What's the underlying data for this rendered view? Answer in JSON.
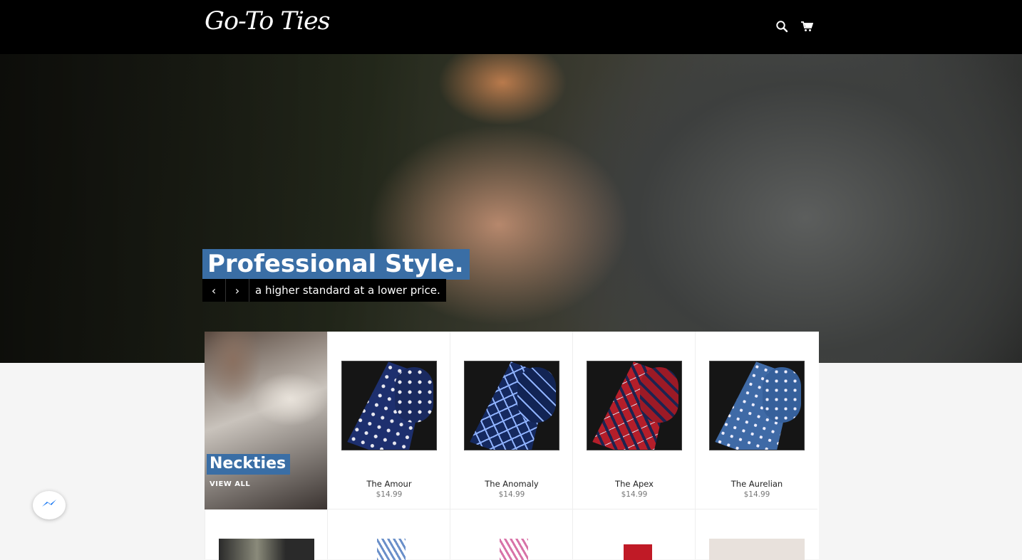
{
  "header": {
    "logo_text": "Go-To Ties",
    "search_icon": "search-icon",
    "cart_icon": "cart-icon",
    "background": "#000000"
  },
  "hero": {
    "title": "Professional Style.",
    "subtitle": "a higher standard at a lower price.",
    "prev_label": "‹",
    "next_label": "›",
    "accent": "#3a6ea5"
  },
  "collection": {
    "title": "Neckties",
    "link": "VIEW ALL"
  },
  "products": [
    {
      "name": "The Amour",
      "price": "$14.99",
      "pattern": "blue floral dots"
    },
    {
      "name": "The Anomaly",
      "price": "$14.99",
      "pattern": "navy plaid"
    },
    {
      "name": "The Apex",
      "price": "$14.99",
      "pattern": "red plaid"
    },
    {
      "name": "The Aurelian",
      "price": "$14.99",
      "pattern": "blue polka dots"
    }
  ],
  "messenger": {
    "icon": "messenger-icon"
  }
}
